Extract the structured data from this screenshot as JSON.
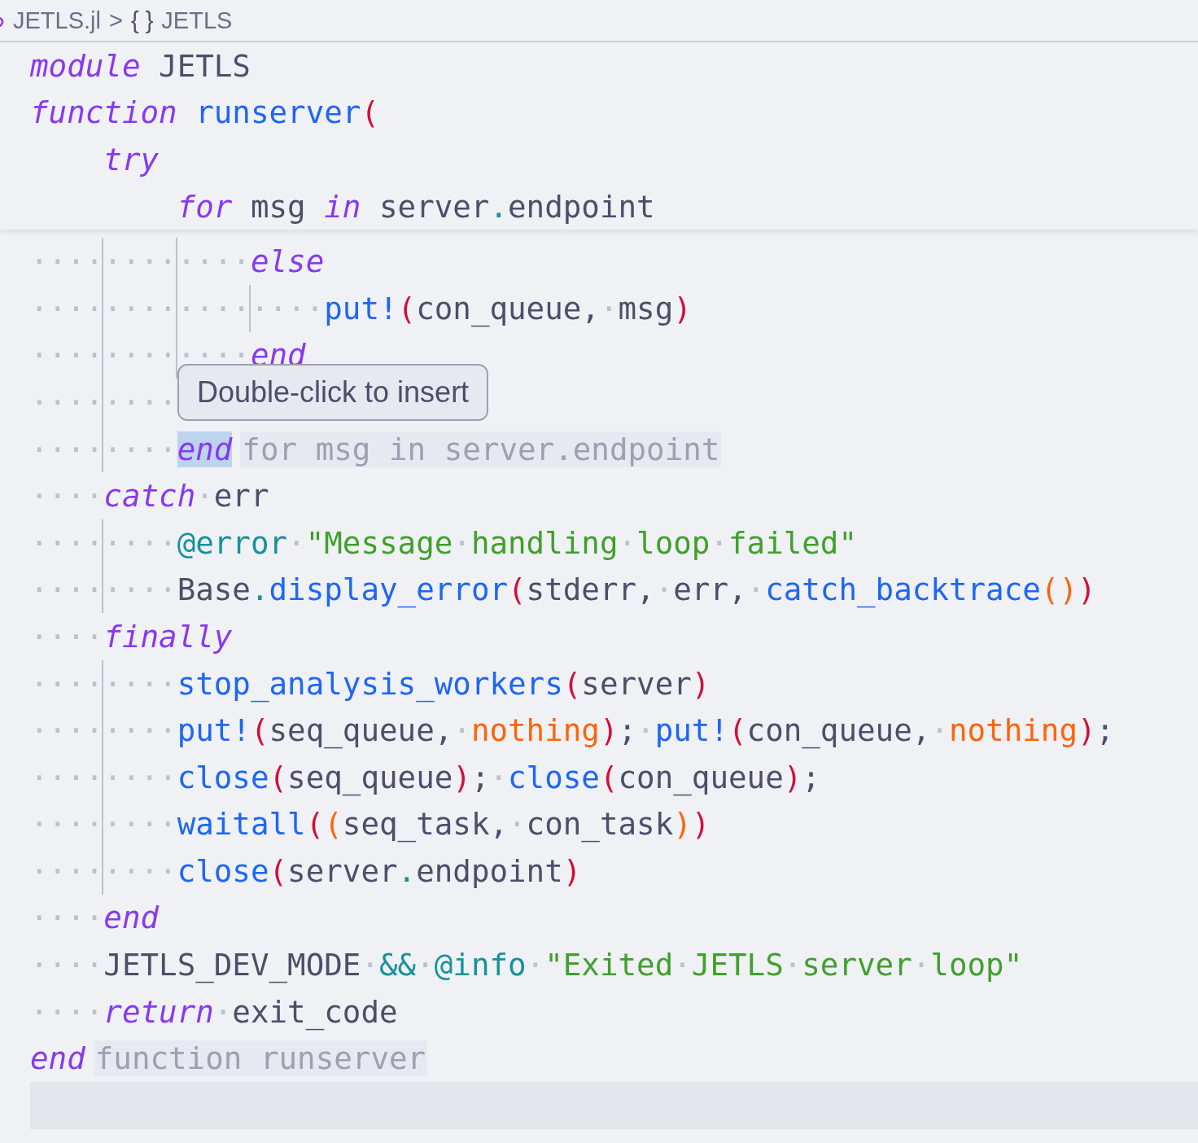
{
  "breadcrumb": {
    "items": [
      {
        "label": "JETLS.jl",
        "kind": "file"
      },
      {
        "label": "JETLS",
        "kind": "module",
        "symbol": "{ }"
      }
    ],
    "separator": ">"
  },
  "sticky_lines": [
    {
      "tokens": [
        {
          "text": "module",
          "kind": "kw"
        },
        {
          "text": " JETLS",
          "kind": "plain"
        }
      ]
    },
    {
      "tokens": [
        {
          "text": "function",
          "kind": "kw"
        },
        {
          "text": " runserver",
          "kind": "fn"
        },
        {
          "text": "(",
          "kind": "paren"
        }
      ],
      "children": [
        {
          "tokens": [
            {
              "text": "try",
              "kind": "kw"
            }
          ],
          "children": [
            {
              "tokens": [
                {
                  "text": "for",
                  "kind": "kw"
                },
                {
                  "text": " msg ",
                  "kind": "plain"
                },
                {
                  "text": "in",
                  "kind": "kw"
                },
                {
                  "text": " server",
                  "kind": "plain"
                },
                {
                  "text": ".",
                  "kind": "op"
                },
                {
                  "text": "endpoint",
                  "kind": "plain"
                }
              ]
            }
          ]
        }
      ]
    }
  ],
  "lines": [
    {
      "indent": "············",
      "tokens": [
        {
          "text": "else",
          "kind": "kw"
        }
      ]
    },
    {
      "indent": "················",
      "tokens": [
        {
          "text": "put!",
          "kind": "fn"
        },
        {
          "text": "(",
          "kind": "paren"
        },
        {
          "text": "con_queue,·msg",
          "kind": "plain"
        },
        {
          "text": ")",
          "kind": "paren"
        }
      ]
    },
    {
      "indent": "············",
      "tokens": [
        {
          "text": "end",
          "kind": "kw"
        }
      ]
    },
    {
      "indent": "········"
    },
    {
      "indent": "········",
      "tokens": [
        {
          "text": "end",
          "kind": "kw",
          "selected": true
        }
      ],
      "hint": "for msg in server.endpoint"
    },
    {
      "indent": "····",
      "tokens": [
        {
          "text": "catch",
          "kind": "kw"
        },
        {
          "text": "·err",
          "kind": "plain"
        }
      ]
    },
    {
      "indent": "········",
      "tokens": [
        {
          "text": "@error",
          "kind": "macro"
        },
        {
          "text": "·",
          "kind": "plain"
        },
        {
          "text": "\"Message·handling·loop·failed\"",
          "kind": "str"
        }
      ]
    },
    {
      "indent": "········",
      "tokens": [
        {
          "text": "Base",
          "kind": "plain"
        },
        {
          "text": ".",
          "kind": "op"
        },
        {
          "text": "display_error",
          "kind": "fn"
        },
        {
          "text": "(",
          "kind": "paren"
        },
        {
          "text": "stderr,·err,·",
          "kind": "plain"
        },
        {
          "text": "catch_backtrace",
          "kind": "fn"
        },
        {
          "text": "()",
          "kind": "paren2"
        },
        {
          "text": ")",
          "kind": "paren"
        }
      ]
    },
    {
      "indent": "····",
      "tokens": [
        {
          "text": "finally",
          "kind": "kw"
        }
      ]
    },
    {
      "indent": "········",
      "tokens": [
        {
          "text": "stop_analysis_workers",
          "kind": "fn"
        },
        {
          "text": "(",
          "kind": "paren"
        },
        {
          "text": "server",
          "kind": "plain"
        },
        {
          "text": ")",
          "kind": "paren"
        }
      ]
    },
    {
      "indent": "········",
      "tokens": [
        {
          "text": "put!",
          "kind": "fn"
        },
        {
          "text": "(",
          "kind": "paren"
        },
        {
          "text": "seq_queue,·",
          "kind": "plain"
        },
        {
          "text": "nothing",
          "kind": "const"
        },
        {
          "text": ")",
          "kind": "paren"
        },
        {
          "text": ";·",
          "kind": "plain"
        },
        {
          "text": "put!",
          "kind": "fn"
        },
        {
          "text": "(",
          "kind": "paren"
        },
        {
          "text": "con_queue,·",
          "kind": "plain"
        },
        {
          "text": "nothing",
          "kind": "const"
        },
        {
          "text": ")",
          "kind": "paren"
        },
        {
          "text": ";",
          "kind": "plain"
        }
      ]
    },
    {
      "indent": "········",
      "tokens": [
        {
          "text": "close",
          "kind": "fn"
        },
        {
          "text": "(",
          "kind": "paren"
        },
        {
          "text": "seq_queue",
          "kind": "plain"
        },
        {
          "text": ")",
          "kind": "paren"
        },
        {
          "text": ";·",
          "kind": "plain"
        },
        {
          "text": "close",
          "kind": "fn"
        },
        {
          "text": "(",
          "kind": "paren"
        },
        {
          "text": "con_queue",
          "kind": "plain"
        },
        {
          "text": ")",
          "kind": "paren"
        },
        {
          "text": ";",
          "kind": "plain"
        }
      ]
    },
    {
      "indent": "········",
      "tokens": [
        {
          "text": "waitall",
          "kind": "fn"
        },
        {
          "text": "(",
          "kind": "paren"
        },
        {
          "text": "(",
          "kind": "paren2"
        },
        {
          "text": "seq_task,·con_task",
          "kind": "plain"
        },
        {
          "text": ")",
          "kind": "paren2"
        },
        {
          "text": ")",
          "kind": "paren"
        }
      ]
    },
    {
      "indent": "········",
      "tokens": [
        {
          "text": "close",
          "kind": "fn"
        },
        {
          "text": "(",
          "kind": "paren"
        },
        {
          "text": "server",
          "kind": "plain"
        },
        {
          "text": ".",
          "kind": "op"
        },
        {
          "text": "endpoint",
          "kind": "plain"
        },
        {
          "text": ")",
          "kind": "paren"
        }
      ]
    },
    {
      "indent": "····",
      "tokens": [
        {
          "text": "end",
          "kind": "kw"
        }
      ]
    },
    {
      "indent": "····",
      "tokens": [
        {
          "text": "JETLS_DEV_MODE·",
          "kind": "plain"
        },
        {
          "text": "&&",
          "kind": "op"
        },
        {
          "text": "·",
          "kind": "plain"
        },
        {
          "text": "@info",
          "kind": "macro"
        },
        {
          "text": "·",
          "kind": "plain"
        },
        {
          "text": "\"Exited·JETLS·server·loop\"",
          "kind": "str"
        }
      ]
    },
    {
      "indent": "····",
      "tokens": [
        {
          "text": "return",
          "kind": "kw"
        },
        {
          "text": "·exit_code",
          "kind": "plain"
        }
      ]
    },
    {
      "tokens": [
        {
          "text": "end",
          "kind": "kw"
        }
      ],
      "hint": "function runserver"
    },
    {
      "current": true
    }
  ],
  "tooltip": {
    "text": "Double-click to insert"
  }
}
